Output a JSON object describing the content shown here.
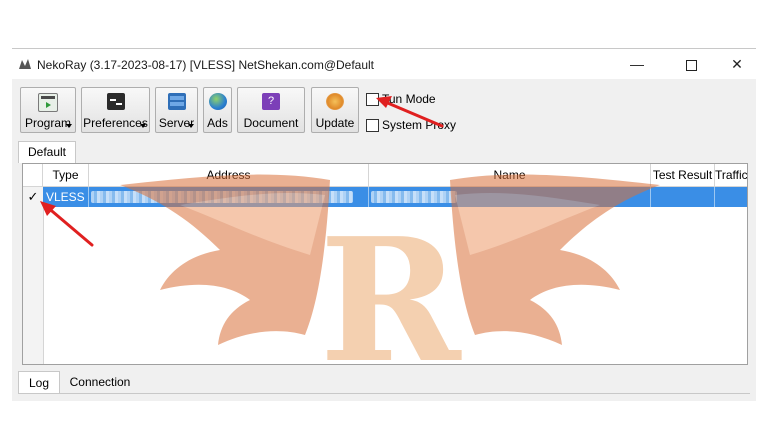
{
  "window": {
    "title": "NekoRay (3.17-2023-08-17) [VLESS] NetShekan.com@Default",
    "controls": {
      "minimize": "—",
      "maximize": "",
      "close": "✕"
    }
  },
  "toolbar": {
    "program_label": "Program",
    "preferences_label": "Preferences",
    "server_label": "Server",
    "ads_label": "Ads",
    "document_label": "Document",
    "update_label": "Update"
  },
  "options": {
    "tun_mode_label": "Tun Mode",
    "tun_mode_checked": false,
    "system_proxy_label": "System Proxy",
    "system_proxy_checked": false
  },
  "group_tabs": [
    {
      "label": "Default",
      "active": true
    }
  ],
  "table": {
    "columns": [
      "Type",
      "Address",
      "Name",
      "Test Result",
      "Traffic"
    ],
    "rows": [
      {
        "checked": "✓",
        "type": "VLESS",
        "address": "",
        "name": "",
        "test_result": "",
        "traffic": "",
        "selected": true
      }
    ]
  },
  "bottom_tabs": [
    {
      "label": "Log",
      "active": true
    },
    {
      "label": "Connection",
      "active": false
    }
  ],
  "colors": {
    "selection": "#3a8ee6",
    "annotation_arrow": "#e02020",
    "watermark": "#d9713a"
  },
  "icons": {
    "program": "program-icon",
    "preferences": "terminal-icon",
    "server": "server-icon",
    "ads": "globe-icon",
    "document": "help-book-icon",
    "update": "update-icon"
  }
}
